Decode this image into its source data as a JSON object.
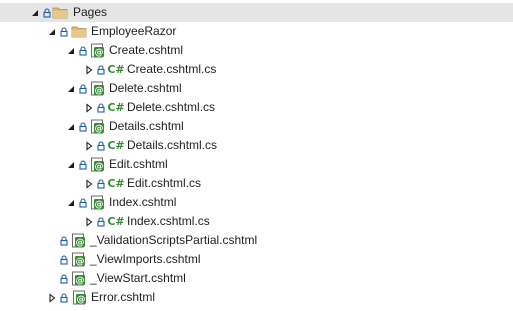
{
  "tree": {
    "items": [
      {
        "label": "Pages",
        "kind": "folder",
        "expander": "expanded",
        "depth": 0
      },
      {
        "label": "EmployeeRazor",
        "kind": "folder",
        "expander": "expanded",
        "depth": 1
      },
      {
        "label": "Create.cshtml",
        "kind": "razor",
        "expander": "expanded",
        "depth": 2
      },
      {
        "label": "Create.cshtml.cs",
        "kind": "csharp",
        "expander": "collapsed",
        "depth": 3
      },
      {
        "label": "Delete.cshtml",
        "kind": "razor",
        "expander": "expanded",
        "depth": 2
      },
      {
        "label": "Delete.cshtml.cs",
        "kind": "csharp",
        "expander": "collapsed",
        "depth": 3
      },
      {
        "label": "Details.cshtml",
        "kind": "razor",
        "expander": "expanded",
        "depth": 2
      },
      {
        "label": "Details.cshtml.cs",
        "kind": "csharp",
        "expander": "collapsed",
        "depth": 3
      },
      {
        "label": "Edit.cshtml",
        "kind": "razor",
        "expander": "expanded",
        "depth": 2
      },
      {
        "label": "Edit.cshtml.cs",
        "kind": "csharp",
        "expander": "collapsed",
        "depth": 3
      },
      {
        "label": "Index.cshtml",
        "kind": "razor",
        "expander": "expanded",
        "depth": 2
      },
      {
        "label": "Index.cshtml.cs",
        "kind": "csharp",
        "expander": "collapsed",
        "depth": 3
      },
      {
        "label": "_ValidationScriptsPartial.cshtml",
        "kind": "razor",
        "expander": "none",
        "depth": 2
      },
      {
        "label": "_ViewImports.cshtml",
        "kind": "razor",
        "expander": "none",
        "depth": 2
      },
      {
        "label": "_ViewStart.cshtml",
        "kind": "razor",
        "expander": "none",
        "depth": 2
      },
      {
        "label": "Error.cshtml",
        "kind": "razor",
        "expander": "collapsed",
        "depth": 1
      }
    ]
  },
  "icons": {
    "csharp_glyph": "C#"
  },
  "colors": {
    "selection": "#e5e5e5",
    "folder": "#dcb67a",
    "lock": "#1c5ea8",
    "razor": "#388a34",
    "csharp": "#388a34",
    "text": "#1e1e1e"
  }
}
